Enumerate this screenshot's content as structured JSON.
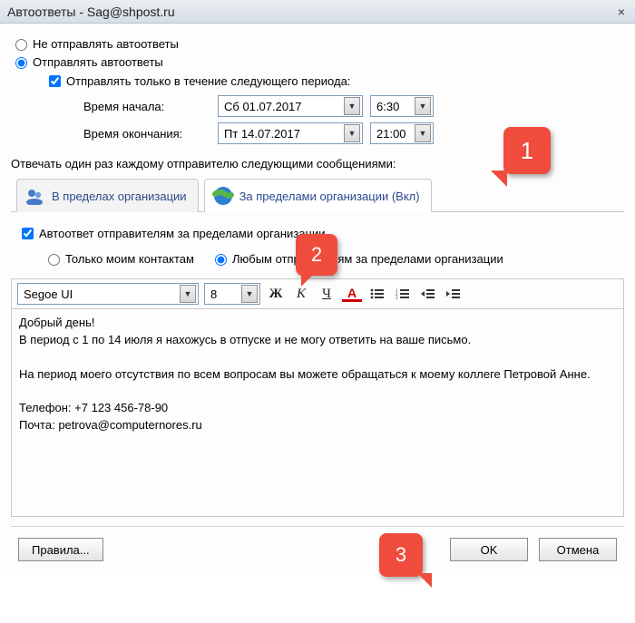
{
  "window": {
    "title": "Автоответы - Sag@shpost.ru",
    "close_icon": "×"
  },
  "radios": {
    "no_send": "Не отправлять автоответы",
    "send": "Отправлять автоответы"
  },
  "period": {
    "checkbox": "Отправлять только в течение следующего периода:",
    "start_label": "Время начала:",
    "start_date": "Сб 01.07.2017",
    "start_time": "6:30",
    "end_label": "Время окончания:",
    "end_date": "Пт 14.07.2017",
    "end_time": "21:00"
  },
  "reply_label": "Отвечать один раз каждому отправителю следующими сообщениями:",
  "tabs": {
    "inside": "В пределах организации",
    "outside": "За пределами организации (Вкл)"
  },
  "outside": {
    "checkbox": "Автоответ отправителям за пределами организации",
    "only_contacts": "Только моим контактам",
    "any_sender": "Любым отправителям за пределами организации"
  },
  "toolbar": {
    "font": "Segoe UI",
    "size": "8",
    "bold": "Ж",
    "italic": "К",
    "underline": "Ч",
    "font_color": "A"
  },
  "editor": {
    "body": "Добрый день!\nВ период с 1 по 14 июля я нахожусь в отпуске и не могу ответить на ваше письмо.\n\nНа период моего отсутствия по всем вопросам вы можете обращаться к моему коллеге Петровой Анне.\n\nТелефон: +7 123 456-78-90\nПочта: petrova@computernores.ru"
  },
  "buttons": {
    "rules": "Правила...",
    "ok": "OK",
    "cancel": "Отмена"
  },
  "callouts": {
    "c1": "1",
    "c2": "2",
    "c3": "3"
  }
}
